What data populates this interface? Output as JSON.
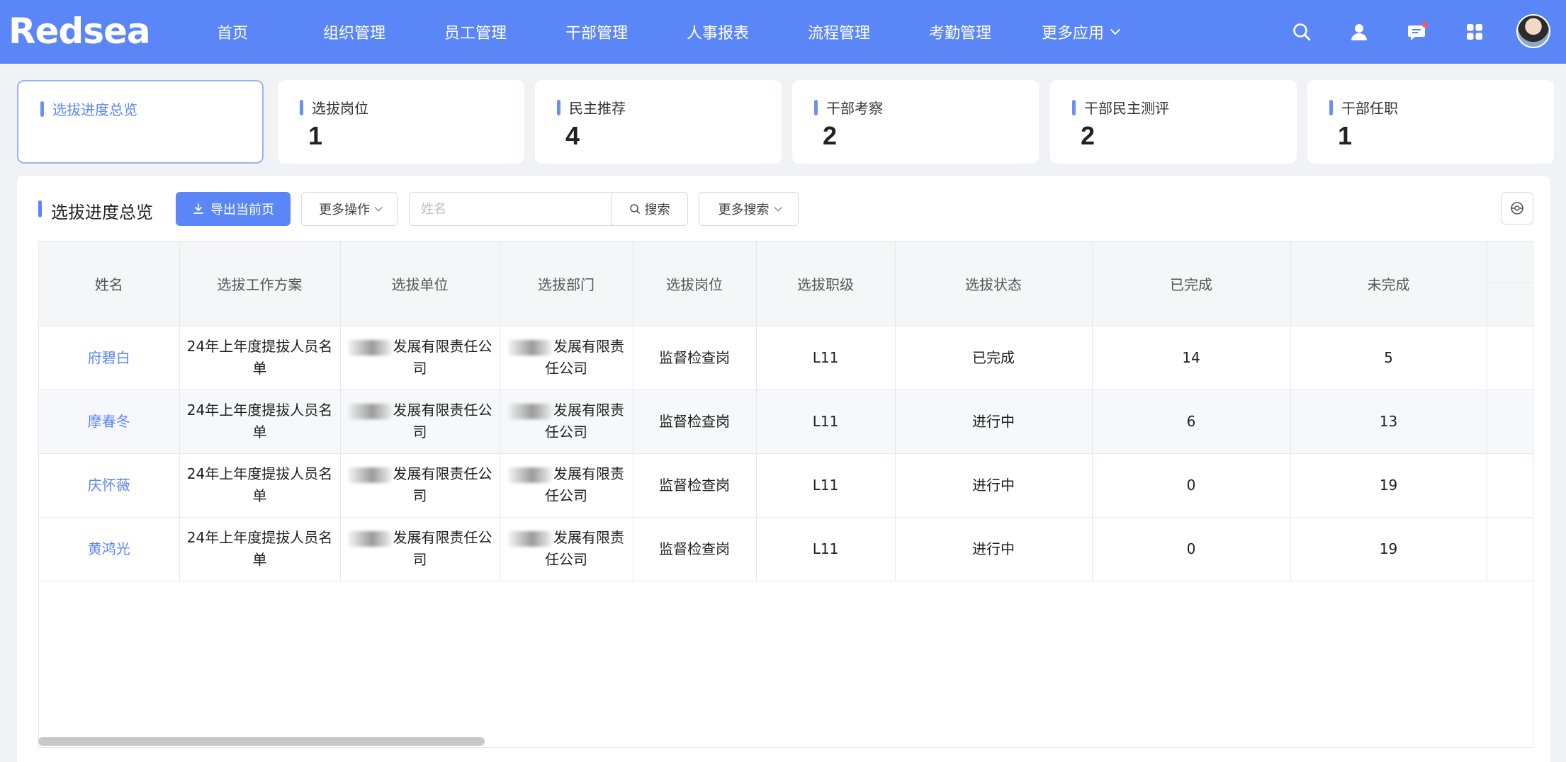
{
  "brand": {
    "logo_text": "Redsea"
  },
  "nav": {
    "items": [
      "首页",
      "组织管理",
      "员工管理",
      "干部管理",
      "人事报表",
      "流程管理",
      "考勤管理",
      "更多应用"
    ]
  },
  "top_icons": [
    "search-icon",
    "user-icon",
    "message-icon",
    "apps-grid-icon"
  ],
  "stats": [
    {
      "label": "选拔进度总览",
      "value": ""
    },
    {
      "label": "选拔岗位",
      "value": "1"
    },
    {
      "label": "民主推荐",
      "value": "4"
    },
    {
      "label": "干部考察",
      "value": "2"
    },
    {
      "label": "干部民主测评",
      "value": "2"
    },
    {
      "label": "干部任职",
      "value": "1"
    }
  ],
  "panel": {
    "title": "选拔进度总览",
    "export_label": "导出当前页",
    "more_ops_label": "更多操作",
    "search_placeholder": "姓名",
    "search_label": "搜索",
    "more_search_label": "更多搜索"
  },
  "table": {
    "headers": [
      "姓名",
      "选拔工作方案",
      "选拔单位",
      "选拔部门",
      "选拔岗位",
      "选拔职级",
      "选拔状态",
      "已完成",
      "未完成",
      ""
    ],
    "rows": [
      {
        "name": "府碧白",
        "plan": "24年上年度提拔人员名单",
        "unit": "发展有限责任公司",
        "dept": "发展有限责任公司",
        "post": "监督检查岗",
        "level": "L11",
        "status": "已完成",
        "done": "14",
        "todo": "5"
      },
      {
        "name": "摩春冬",
        "plan": "24年上年度提拔人员名单",
        "unit": "发展有限责任公司",
        "dept": "发展有限责任公司",
        "post": "监督检查岗",
        "level": "L11",
        "status": "进行中",
        "done": "6",
        "todo": "13"
      },
      {
        "name": "庆怀薇",
        "plan": "24年上年度提拔人员名单",
        "unit": "发展有限责任公司",
        "dept": "发展有限责任公司",
        "post": "监督检查岗",
        "level": "L11",
        "status": "进行中",
        "done": "0",
        "todo": "19"
      },
      {
        "name": "黄鸿光",
        "plan": "24年上年度提拔人员名单",
        "unit": "发展有限责任公司",
        "dept": "发展有限责任公司",
        "post": "监督检查岗",
        "level": "L11",
        "status": "进行中",
        "done": "0",
        "todo": "19"
      }
    ]
  },
  "colors": {
    "primary": "#5b86f7",
    "header_bg": "#5b86f7",
    "page_bg": "#f0f2f5",
    "notify_dot": "#f5585d"
  }
}
